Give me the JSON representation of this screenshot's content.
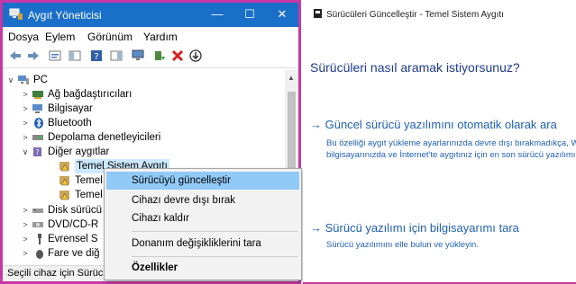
{
  "colors": {
    "titlebar": "#1a6fc9",
    "frame_accent": "#c738a6",
    "context_highlight": "#91c9f7",
    "link_blue": "#1f5fb0"
  },
  "device_manager": {
    "title": "Aygıt Yöneticisi",
    "window_controls": [
      "minimize-icon",
      "maximize-icon",
      "close-icon"
    ],
    "menu": [
      "Dosya",
      "Eylem",
      "Görünüm",
      "Yardım"
    ],
    "toolbar_icons": [
      "back-arrow-icon",
      "forward-arrow-icon",
      "properties-icon",
      "view-icon",
      "help-icon",
      "panel-icon",
      "monitor-icon",
      "update-driver-icon",
      "uninstall-x-icon",
      "download-icon"
    ],
    "tree": [
      {
        "label": "PC",
        "expanded": true
      },
      {
        "label": "Ağ bağdaştırıcıları"
      },
      {
        "label": "Bilgisayar"
      },
      {
        "label": "Bluetooth"
      },
      {
        "label": "Depolama denetleyicileri"
      },
      {
        "label": "Diğer aygıtlar",
        "expanded": true
      },
      {
        "label": "Temel Sistem Aygıtı"
      },
      {
        "label": "Temel"
      },
      {
        "label": "Temel"
      },
      {
        "label": "Disk sürücü"
      },
      {
        "label": "DVD/CD-R"
      },
      {
        "label": "Evrensel S"
      },
      {
        "label": "Fare ve diğ"
      }
    ],
    "status": "Seçili cihaz için Sürücü"
  },
  "context_menu": {
    "items": [
      {
        "label": "Sürücüyü güncelleştir",
        "highlighted": true
      },
      {
        "label": "Cihazı devre dışı bırak"
      },
      {
        "label": "Cihazı kaldır"
      },
      {
        "label": "Donanım değişikliklerini tara"
      },
      {
        "label": "Özellikler",
        "bold": true
      }
    ]
  },
  "update_wizard": {
    "header": "Sürücüleri Güncelleştir - Temel Sistem Aygıtı",
    "question": "Sürücüleri nasıl aramak istiyorsunuz?",
    "option_auto": {
      "title": "→ Güncel sürücü yazılımını otomatik olarak ara",
      "desc_line1": "Bu özelliği aygıt yükleme ayarlarınızda devre dışı bırakmadıkça, Windows",
      "desc_line2": "bilgisayarınızda ve İnternet'te aygıtınız için en son sürücü yazılımını arar."
    },
    "option_manual": {
      "title": "→ Sürücü yazılımı için bilgisayarımı tara",
      "desc": "Sürücü yazılımını elle bulun ve yükleyin."
    }
  }
}
